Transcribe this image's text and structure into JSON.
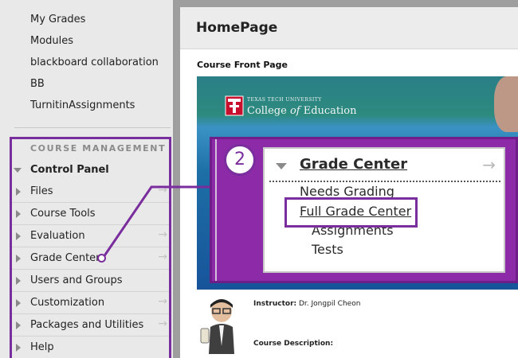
{
  "sidebar": {
    "top_links": [
      "My Grades",
      "Modules",
      "blackboard collaboration",
      "BB",
      "TurnitinAssignments"
    ],
    "section_heading": "COURSE MANAGEMENT",
    "control_panel_label": "Control Panel",
    "items": [
      {
        "label": "Files",
        "arrow": "→"
      },
      {
        "label": "Course Tools",
        "arrow": ""
      },
      {
        "label": "Evaluation",
        "arrow": "→"
      },
      {
        "label": "Grade Center",
        "arrow": "→"
      },
      {
        "label": "Users and Groups",
        "arrow": ""
      },
      {
        "label": "Customization",
        "arrow": "→"
      },
      {
        "label": "Packages and Utilities",
        "arrow": "→"
      },
      {
        "label": "Help",
        "arrow": ""
      }
    ]
  },
  "main": {
    "title": "HomePage",
    "front_page_label": "Course Front Page",
    "banner": {
      "university": "TEXAS TECH UNIVERSITY",
      "college_prefix": "College ",
      "college_of": "of",
      "college_suffix": " Education"
    },
    "step_number": "2",
    "grade_center": {
      "title": "Grade Center",
      "arrow": "→",
      "items": [
        "Needs Grading",
        "Full Grade Center",
        "Assignments",
        "Tests"
      ]
    },
    "instructor_label": "Instructor:",
    "instructor_name": "Dr. Jongpil Cheon",
    "description_label": "Course Description:"
  },
  "colors": {
    "accent_purple": "#7a2d9c",
    "overlay_purple": "#8c2aa8",
    "sidebar_bg": "#e9e9e9",
    "banner_blue": "#17549a"
  }
}
